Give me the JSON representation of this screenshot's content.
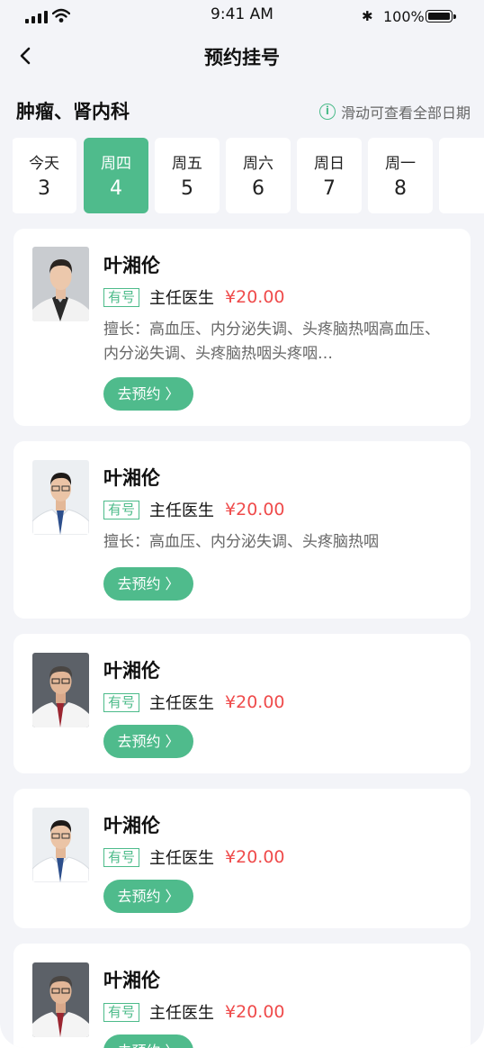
{
  "status_bar": {
    "time": "9:41 AM",
    "battery": "100%"
  },
  "nav": {
    "title": "预约挂号"
  },
  "department": "肿瘤、肾内科",
  "swipe_hint": "滑动可查看全部日期",
  "dates": [
    {
      "weekday": "今天",
      "day": "3",
      "selected": false
    },
    {
      "weekday": "周四",
      "day": "4",
      "selected": true
    },
    {
      "weekday": "周五",
      "day": "5",
      "selected": false
    },
    {
      "weekday": "周六",
      "day": "6",
      "selected": false
    },
    {
      "weekday": "周日",
      "day": "7",
      "selected": false
    },
    {
      "weekday": "周一",
      "day": "8",
      "selected": false
    },
    {
      "weekday": "",
      "day": "",
      "selected": false
    }
  ],
  "doctors": [
    {
      "name": "叶湘伦",
      "tag": "有号",
      "title": "主任医生",
      "price": "¥20.00",
      "expertise": "擅长：高血压、内分泌失调、头疼脑热咽高血压、内分泌失调、头疼脑热咽头疼咽…",
      "button": "去预约 〉"
    },
    {
      "name": "叶湘伦",
      "tag": "有号",
      "title": "主任医生",
      "price": "¥20.00",
      "expertise": "擅长：高血压、内分泌失调、头疼脑热咽",
      "button": "去预约 〉"
    },
    {
      "name": "叶湘伦",
      "tag": "有号",
      "title": "主任医生",
      "price": "¥20.00",
      "expertise": "",
      "button": "去预约 〉"
    },
    {
      "name": "叶湘伦",
      "tag": "有号",
      "title": "主任医生",
      "price": "¥20.00",
      "expertise": "",
      "button": "去预约 〉"
    },
    {
      "name": "叶湘伦",
      "tag": "有号",
      "title": "主任医生",
      "price": "¥20.00",
      "expertise": "",
      "button": "去预约 〉"
    }
  ],
  "colors": {
    "accent": "#4fbb8c",
    "price": "#ef4b4b",
    "background": "#f3f4f8"
  }
}
